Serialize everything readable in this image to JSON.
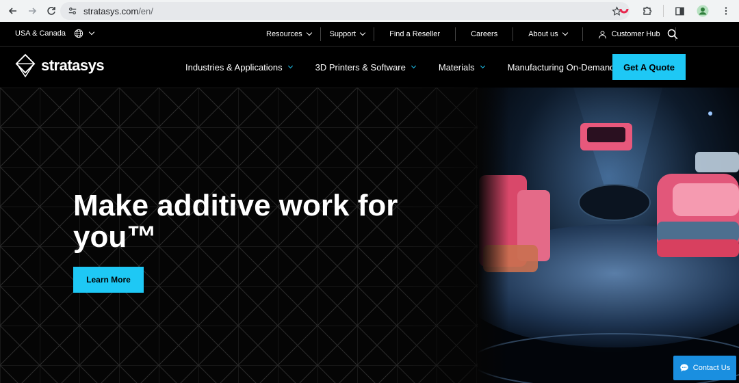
{
  "browser": {
    "url_host": "stratasys.com",
    "url_path": "/en/"
  },
  "util_nav": {
    "region_label": "USA & Canada",
    "links": [
      {
        "label": "Resources"
      },
      {
        "label": "Support"
      },
      {
        "label": "Find a Reseller"
      },
      {
        "label": "Careers"
      },
      {
        "label": "About us"
      },
      {
        "label": "Customer Hub"
      }
    ]
  },
  "main_nav": {
    "logo_text": "stratasys",
    "links": [
      {
        "label": "Industries & Applications"
      },
      {
        "label": "3D Printers & Software"
      },
      {
        "label": "Materials"
      },
      {
        "label": "Manufacturing On-Demand"
      }
    ],
    "cta_label": "Get A Quote"
  },
  "hero": {
    "title": "Make additive work for you™",
    "button_label": "Learn More"
  },
  "chat": {
    "label": "Contact Us"
  },
  "colors": {
    "accent": "#1ec8f5",
    "chat": "#1a8fe0",
    "background": "#000000"
  }
}
